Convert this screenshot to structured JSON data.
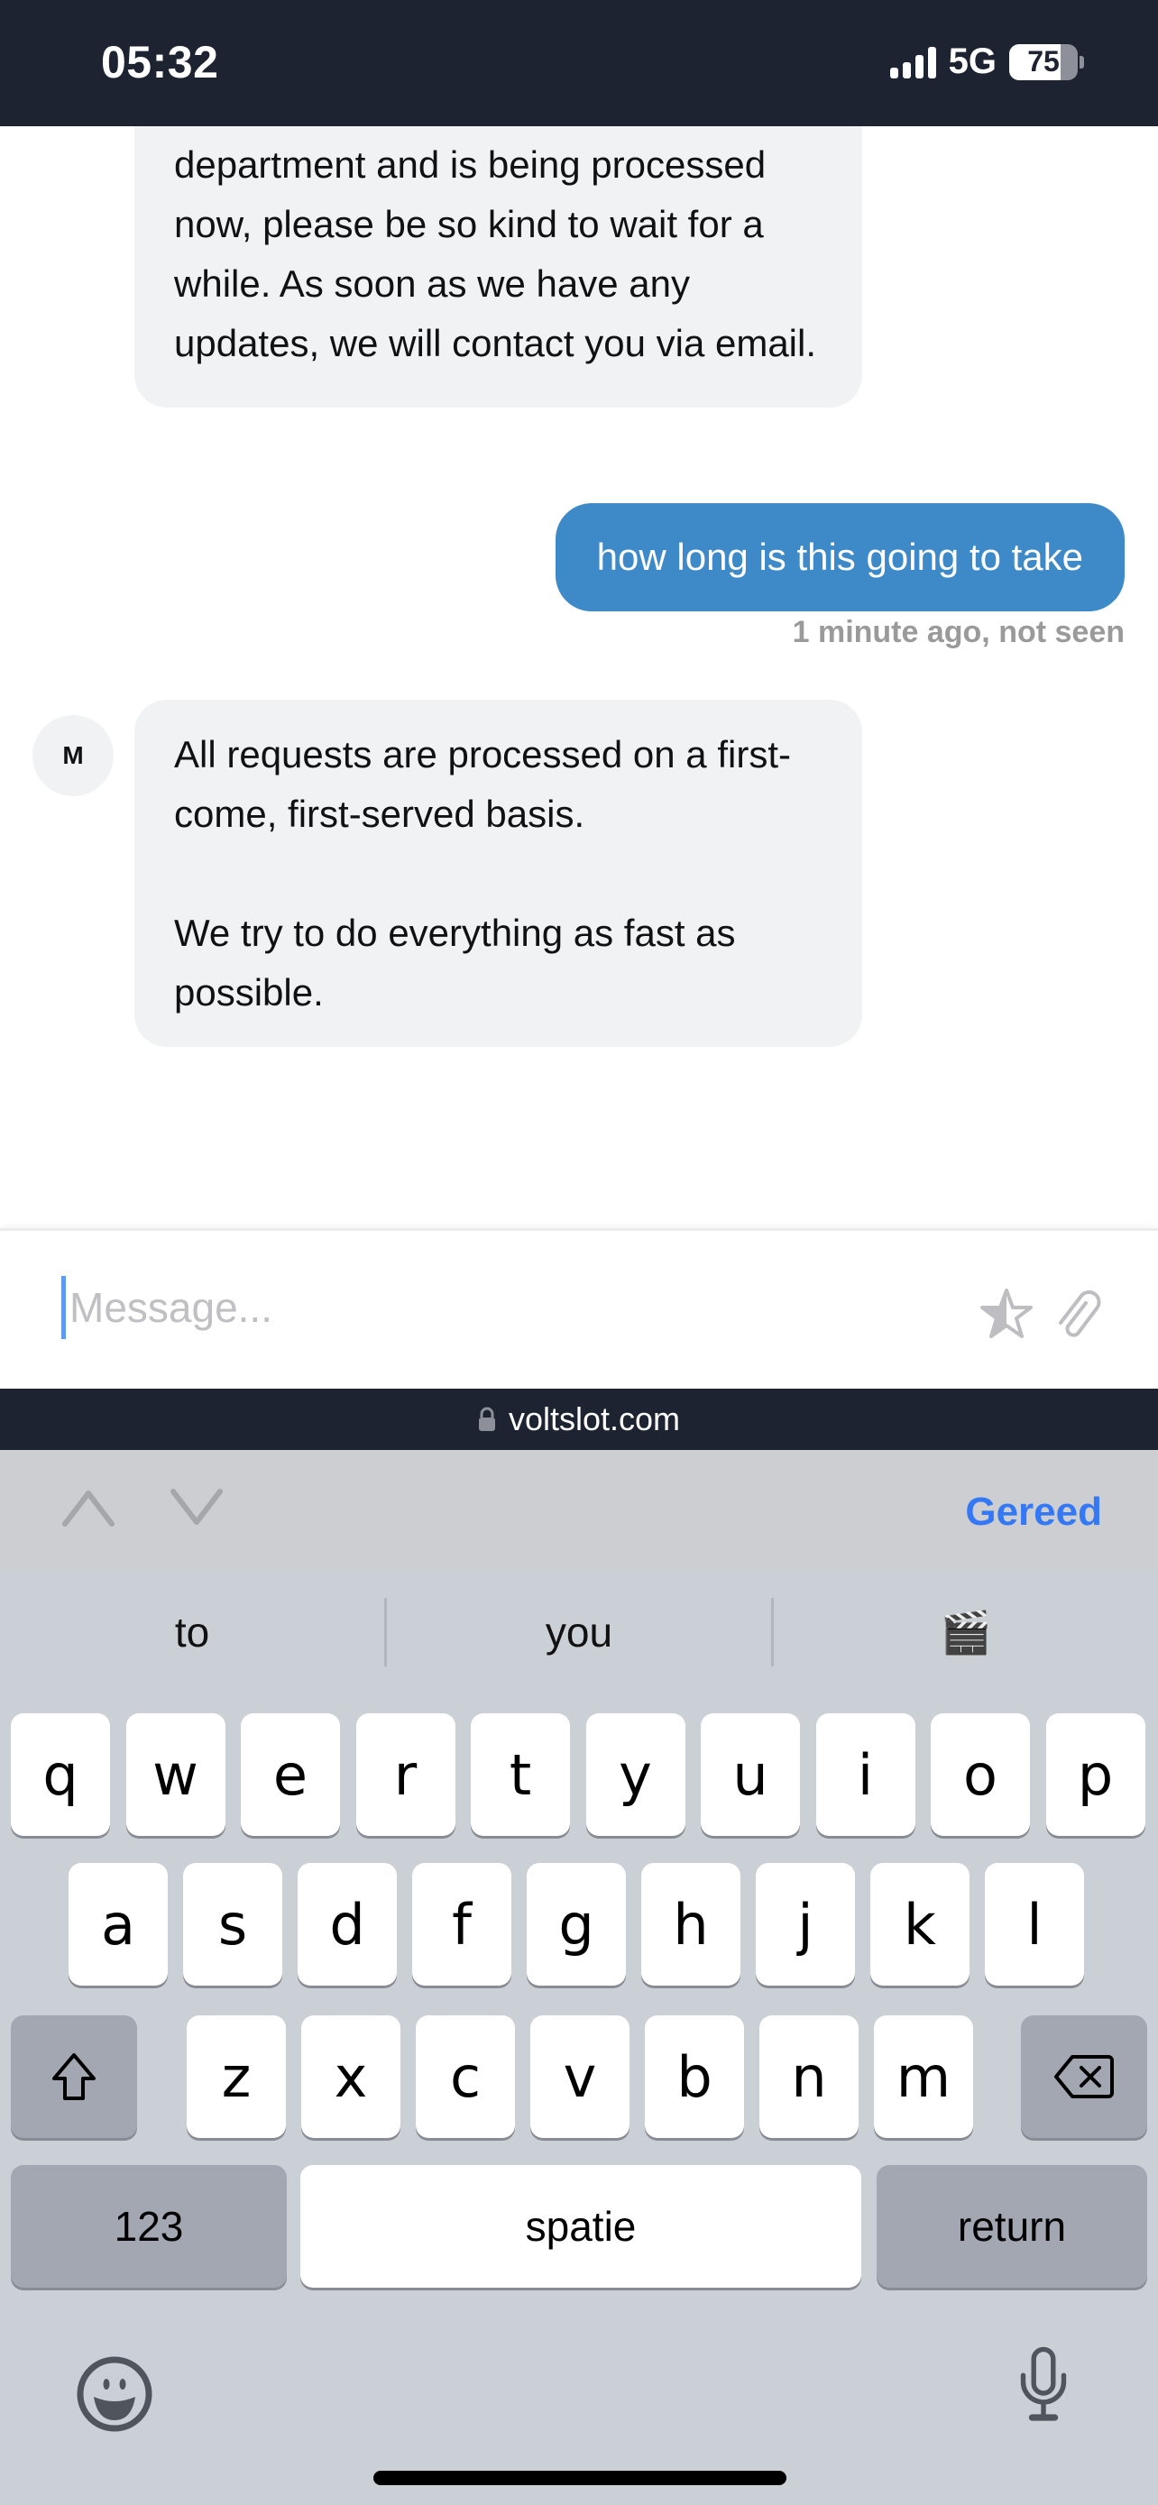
{
  "status_bar": {
    "time": "05:32",
    "network": "5G",
    "battery_level": 75,
    "battery_label": "75",
    "signal_bars": 4
  },
  "chat": {
    "messages": [
      {
        "sender": "agent",
        "paragraphs": [
          "department and is being processed now, please be so kind to wait for a while. As soon as we have any updates, we will contact you via email."
        ]
      },
      {
        "sender": "user",
        "text": "how long is this going to take",
        "status": "1 minute ago, not seen"
      },
      {
        "sender": "agent",
        "avatar_initial": "M",
        "paragraphs": [
          "All requests are processed on a first-come, first-served basis.",
          "We try to do everything as fast as possible."
        ]
      }
    ]
  },
  "composer": {
    "placeholder": "Message...",
    "value": "",
    "icons": [
      "star-half-icon",
      "paperclip-icon"
    ]
  },
  "url_bar": {
    "domain": "voltslot.com",
    "icon": "lock-icon"
  },
  "keyboard": {
    "toolbar": {
      "done_label": "Gereed",
      "accent_color": "#3578f6"
    },
    "suggestions": [
      "to",
      "you",
      "🎬"
    ],
    "rows": [
      [
        "q",
        "w",
        "e",
        "r",
        "t",
        "y",
        "u",
        "i",
        "o",
        "p"
      ],
      [
        "a",
        "s",
        "d",
        "f",
        "g",
        "h",
        "j",
        "k",
        "l"
      ],
      [
        "z",
        "x",
        "c",
        "v",
        "b",
        "n",
        "m"
      ]
    ],
    "numbers_label": "123",
    "space_label": "spatie",
    "return_label": "return"
  },
  "colors": {
    "header_bg": "#1d2331",
    "user_bubble": "#3e89c8",
    "agent_bubble": "#f1f2f4"
  }
}
